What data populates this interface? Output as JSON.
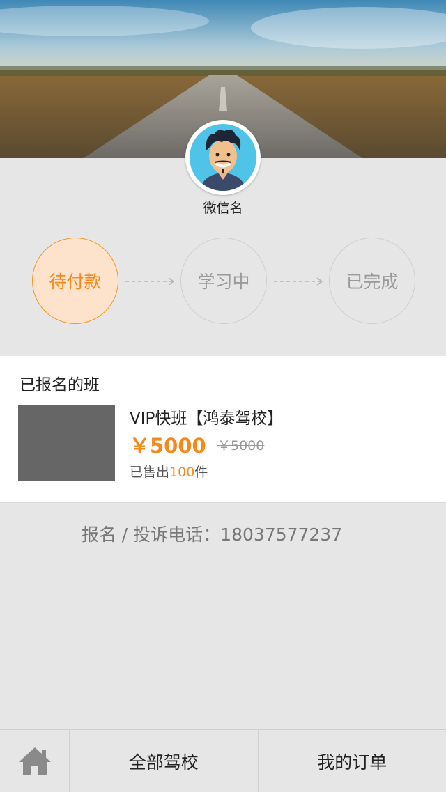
{
  "profile": {
    "nickname": "微信名"
  },
  "steps": [
    {
      "label": "待付款",
      "state": "active"
    },
    {
      "label": "学习中",
      "state": "idle"
    },
    {
      "label": "已完成",
      "state": "idle"
    }
  ],
  "enrolled": {
    "title": "已报名的班",
    "course": {
      "name": "VIP快班【鸿泰驾校】",
      "price": "￥5000",
      "original_price": "￥5000",
      "sold_prefix": "已售出",
      "sold_count": "100",
      "sold_suffix": "件"
    }
  },
  "hotline": "报名 / 投诉电话：18037577237",
  "tabbar": {
    "home_icon": "home-icon",
    "items": [
      {
        "label": "全部驾校"
      },
      {
        "label": "我的订单"
      }
    ]
  },
  "colors": {
    "accent": "#f5891a",
    "active_fill": "#fde3cc",
    "background": "#e6e6e6"
  }
}
